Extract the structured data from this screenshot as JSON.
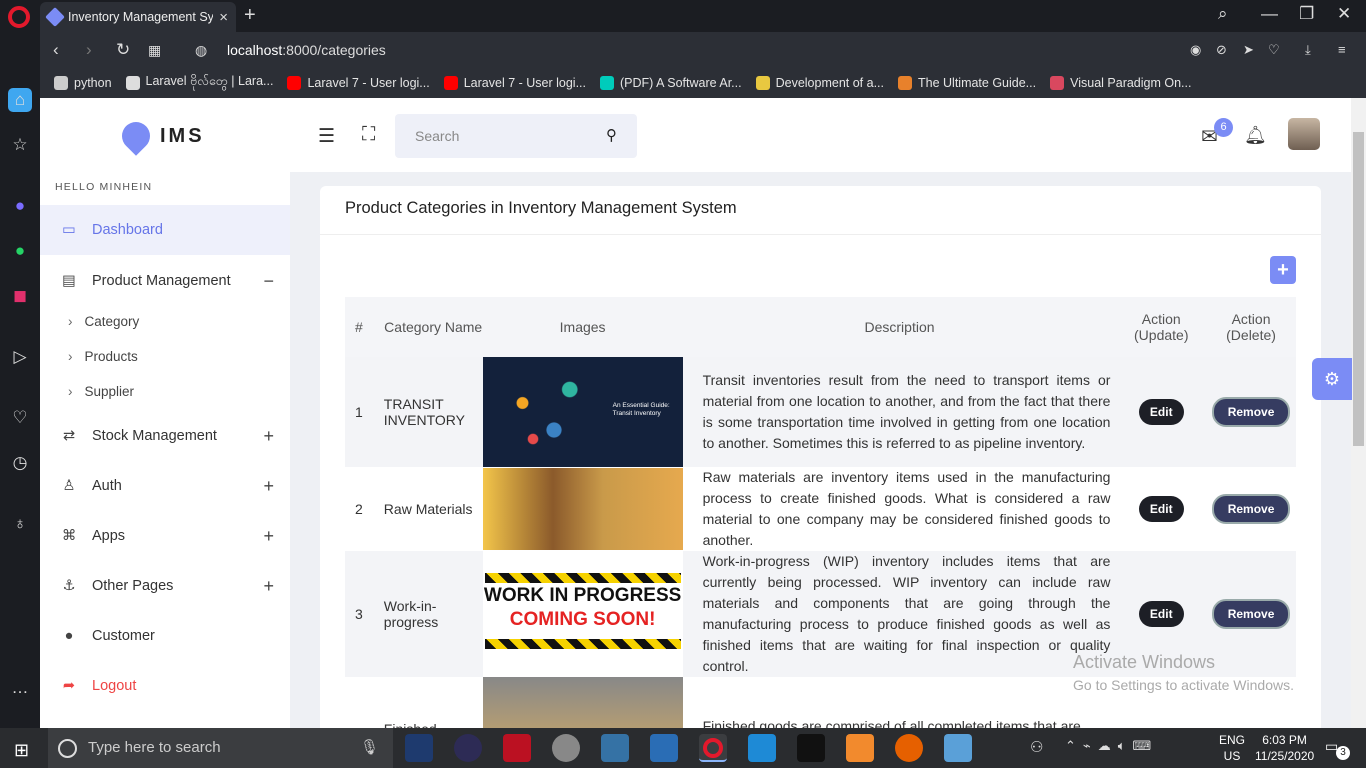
{
  "browser": {
    "tab_title": "Inventory Management Sys",
    "url_host": "localhost",
    "url_rest": ":8000/categories",
    "bookmarks": [
      {
        "label": "python",
        "color": "#cccccc"
      },
      {
        "label": "Laravel ဗိုလ်တွေ | Lara...",
        "color": "#dddddd"
      },
      {
        "label": "Laravel 7 - User logi...",
        "color": "#ff0000"
      },
      {
        "label": "Laravel 7 - User logi...",
        "color": "#ff0000"
      },
      {
        "label": "(PDF) A Software Ar...",
        "color": "#00ccbb"
      },
      {
        "label": "Development of a...",
        "color": "#e8c840"
      },
      {
        "label": "The Ultimate Guide...",
        "color": "#e8812b"
      },
      {
        "label": "Visual Paradigm On...",
        "color": "#d9485f"
      }
    ]
  },
  "app": {
    "brand": "IMS",
    "greeting": "HELLO MINHEIN",
    "search_placeholder": "Search",
    "mail_badge": "6",
    "accent": "#7b8cf5"
  },
  "sidebar": {
    "items": [
      {
        "label": "Dashboard",
        "icon": "monitor-icon",
        "toggle": ""
      },
      {
        "label": "Product Management",
        "icon": "box-icon",
        "toggle": "−"
      },
      {
        "label": "Stock Management",
        "icon": "transfer-icon",
        "toggle": "+"
      },
      {
        "label": "Auth",
        "icon": "user-icon",
        "toggle": "+"
      },
      {
        "label": "Apps",
        "icon": "command-icon",
        "toggle": "+"
      },
      {
        "label": "Other Pages",
        "icon": "anchor-icon",
        "toggle": "+"
      },
      {
        "label": "Customer",
        "icon": "user-circle-icon",
        "toggle": ""
      },
      {
        "label": "Logout",
        "icon": "logout-icon",
        "toggle": ""
      }
    ],
    "subitems": [
      "Category",
      "Products",
      "Supplier"
    ]
  },
  "card": {
    "title": "Product Categories in Inventory Management System",
    "add_label": "+",
    "columns": [
      "#",
      "Category Name",
      "Images",
      "Description",
      "Action (Update)",
      "Action (Delete)"
    ],
    "edit_label": "Edit",
    "remove_label": "Remove",
    "rows": [
      {
        "num": "1",
        "name": "TRANSIT INVENTORY",
        "img_text": "An Essential Guide: Transit Inventory",
        "description": "Transit inventories result from the need to transport items or material from one location to another, and from the fact that there is some transportation time involved in getting from one location to another. Sometimes this is referred to as pipeline inventory."
      },
      {
        "num": "2",
        "name": "Raw Materials",
        "img_text": "",
        "description": "Raw materials are inventory items used in the manufacturing process to create finished goods. What is considered a raw material to one company may be considered finished goods to another."
      },
      {
        "num": "3",
        "name": "Work-in-progress",
        "img_text": "WORK IN PROGRESS",
        "img_text2": "COMING SOON!",
        "description": "Work-in-progress (WIP) inventory includes items that are currently being processed. WIP inventory can include raw materials and components that are going through the manufacturing process to produce finished goods as well as finished items that are waiting for final inspection or quality control."
      },
      {
        "num": "",
        "name": "Finished",
        "img_text": "",
        "description": "Finished goods are comprised of all completed items that are"
      }
    ]
  },
  "watermark": {
    "line1": "Activate Windows",
    "line2": "Go to Settings to activate Windows."
  },
  "taskbar": {
    "search_placeholder": "Type here to search",
    "lang": "ENG",
    "region": "US",
    "time": "6:03 PM",
    "date": "11/25/2020",
    "notif_count": "3"
  }
}
